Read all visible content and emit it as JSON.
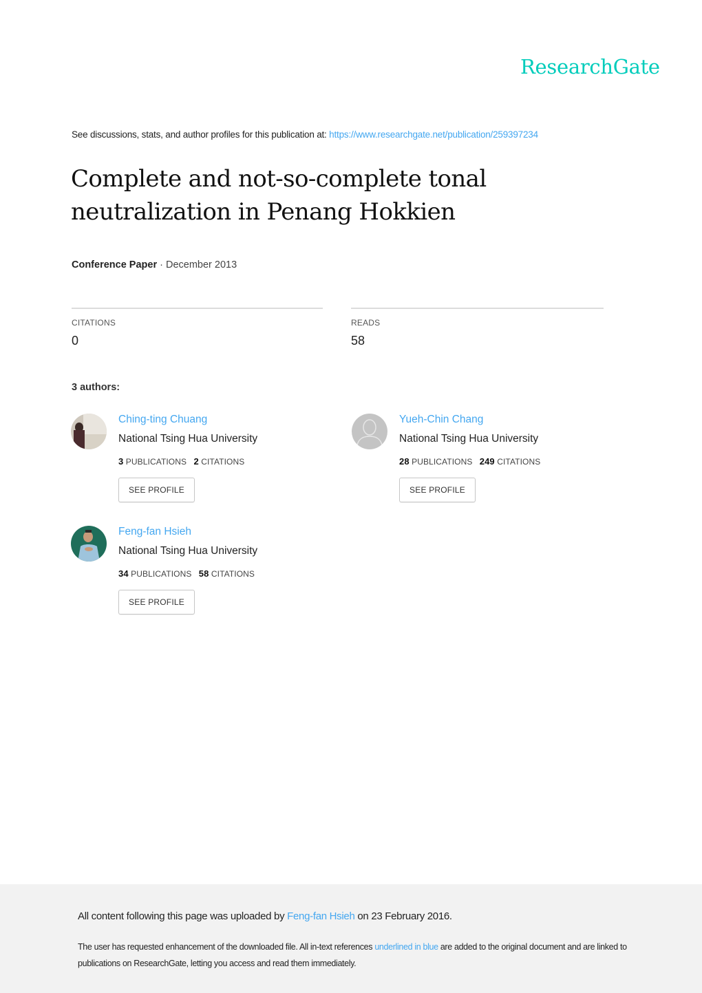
{
  "brand": {
    "logo_text": "ResearchGate",
    "accent_color": "#00ccbb",
    "link_color": "#44a7f0"
  },
  "header": {
    "discussion_text": "See discussions, stats, and author profiles for this publication at: ",
    "publication_url": "https://www.researchgate.net/publication/259397234"
  },
  "publication": {
    "title": "Complete and not-so-complete tonal neutralization in Penang Hokkien",
    "type": "Conference Paper",
    "separator": " · ",
    "date": "December 2013"
  },
  "stats": {
    "citations_label": "CITATIONS",
    "citations_value": "0",
    "reads_label": "READS",
    "reads_value": "58"
  },
  "authors_heading": "3 authors:",
  "authors": [
    {
      "name": "Ching-ting Chuang",
      "institution": "National Tsing Hua University",
      "publications": "3",
      "publications_label": "PUBLICATIONS",
      "citations": "2",
      "citations_label": "CITATIONS",
      "button_label": "SEE PROFILE",
      "avatar": "photo"
    },
    {
      "name": "Yueh-Chin Chang",
      "institution": "National Tsing Hua University",
      "publications": "28",
      "publications_label": "PUBLICATIONS",
      "citations": "249",
      "citations_label": "CITATIONS",
      "button_label": "SEE PROFILE",
      "avatar": "default-user-icon"
    },
    {
      "name": "Feng-fan Hsieh",
      "institution": "National Tsing Hua University",
      "publications": "34",
      "publications_label": "PUBLICATIONS",
      "citations": "58",
      "citations_label": "CITATIONS",
      "button_label": "SEE PROFILE",
      "avatar": "photo"
    }
  ],
  "footer": {
    "upload_prefix": "All content following this page was uploaded by ",
    "uploader": "Feng-fan Hsieh",
    "upload_suffix": " on 23 February 2016.",
    "note_prefix": "The user has requested enhancement of the downloaded file. All in-text references ",
    "note_link": "underlined in blue",
    "note_suffix": " are added to the original document and are linked to publications on ResearchGate, letting you access and read them immediately."
  }
}
